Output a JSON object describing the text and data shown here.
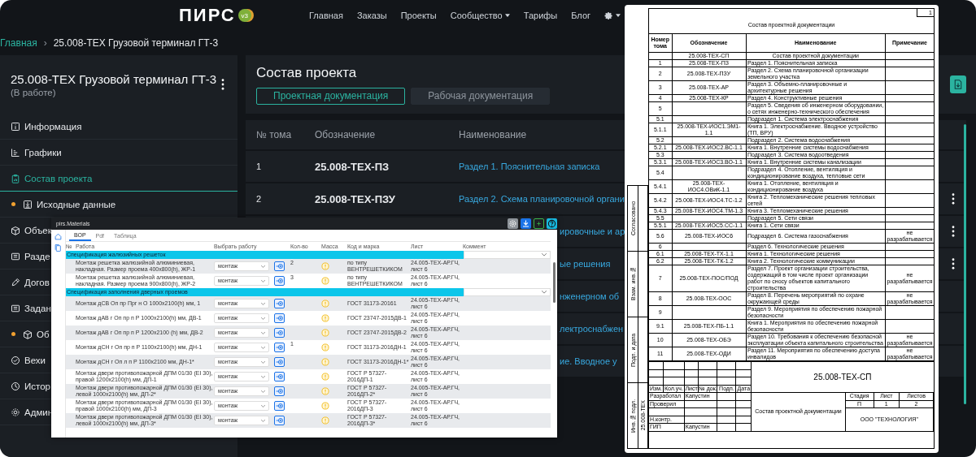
{
  "header": {
    "logo": "ПИРС",
    "logo_badge": "v3",
    "nav": [
      {
        "label": "Главная",
        "dropdown": false
      },
      {
        "label": "Заказы",
        "dropdown": false
      },
      {
        "label": "Проекты",
        "dropdown": false
      },
      {
        "label": "Сообщество",
        "dropdown": true
      },
      {
        "label": "Тарифы",
        "dropdown": false
      },
      {
        "label": "Блог",
        "dropdown": false
      }
    ]
  },
  "breadcrumb": {
    "items": [
      "Главная",
      "25.008-ТЕХ Грузовой терминал ГТ-3"
    ],
    "separator": "›"
  },
  "sidebar": {
    "title": "25.008-ТЕХ Грузовой терминал ГТ-3",
    "status": "(В работе)",
    "items": [
      {
        "label": "Информация",
        "selected": false,
        "dot": false
      },
      {
        "label": "Графики",
        "selected": false,
        "dot": false
      },
      {
        "label": "Состав проекта",
        "selected": true,
        "dot": false
      },
      {
        "label": "Исходные данные",
        "selected": false,
        "dot": true
      },
      {
        "label": "Объек",
        "selected": false,
        "dot": false
      },
      {
        "label": "Разде",
        "selected": false,
        "dot": false
      },
      {
        "label": "Догов",
        "selected": false,
        "dot": false
      },
      {
        "label": "Задан",
        "selected": false,
        "dot": false
      },
      {
        "label": "Об",
        "selected": false,
        "dot": true
      },
      {
        "label": "Вехи",
        "selected": false,
        "dot": false
      },
      {
        "label": "Истор",
        "selected": false,
        "dot": false
      },
      {
        "label": "Админ",
        "selected": false,
        "dot": false
      }
    ]
  },
  "content": {
    "title": "Состав проекта",
    "tabs": [
      {
        "label": "Проектная документация",
        "selected": true
      },
      {
        "label": "Рабочая документация",
        "selected": false
      }
    ],
    "table": {
      "columns": [
        "№ тома",
        "Обозначение",
        "Наименование"
      ],
      "rows": [
        {
          "kind": "full",
          "volume": "1",
          "code": "25.008-ТЕХ-ПЗ",
          "name": "Раздел 1. Пояснительная записка",
          "menu": false
        },
        {
          "kind": "full",
          "volume": "2",
          "code": "25.008-ТЕХ-ПЗУ",
          "name": "Раздел 2. Схема планировочной органи",
          "menu": true
        },
        {
          "kind": "partial",
          "name": "ировочные и ар",
          "menu": true
        },
        {
          "kind": "partial",
          "name": "ые решения",
          "menu": true
        },
        {
          "kind": "partial",
          "name": "нженерном об",
          "menu": false
        },
        {
          "kind": "partial",
          "name": "лектроснабжен",
          "menu": false
        },
        {
          "kind": "partial",
          "name": "ие. Вводное у",
          "menu": false
        }
      ]
    }
  },
  "materials_window": {
    "title": "pirs.Materials",
    "tabs": [
      {
        "label": "ВОР",
        "selected": true
      },
      {
        "label": "Pdf",
        "selected": false
      },
      {
        "label": "Таблица",
        "selected": false
      }
    ],
    "columns": [
      "№",
      "Работа",
      "Выбрать работу",
      "Кол-во",
      "Масса",
      "Код и марка",
      "Лист",
      "Коммент"
    ],
    "groups": [
      {
        "title": "Спецификация жалюзийных решеток",
        "rows": [
          {
            "work": "Монтаж решетка жалюзийной алюминиевая, накладная. Размер проема 400x800(h), ЖР-1",
            "choice": "монтаж",
            "qty": "2",
            "code": "по типу ВЕНТРЕШЕТКИКОМ",
            "sheet": "24.005-ТЕХ-АР.ГЧ, лист 6"
          },
          {
            "work": "Монтаж решетка жалюзийной алюминиевая, накладная. Размер проема 900x800(h), ЖР-2",
            "choice": "монтаж",
            "qty": "3",
            "code": "по типу ВЕНТРЕШЕТКИКОМ",
            "sheet": "24.005-ТЕХ-АР.ГЧ, лист 6"
          }
        ]
      },
      {
        "title": "Спецификация заполнения дверных проемов",
        "rows": [
          {
            "work": "Монтаж дСВ Оп пр Прг н О 1000x2100(h) мм, 1",
            "choice": "монтаж",
            "code": "ГОСТ 31173-20161",
            "sheet": "24.005-ТЕХ-АР.ГЧ, лист 6"
          },
          {
            "work": "Монтаж дАВ г Оп пр п Р 1000x2100(h) мм, ДВ-1",
            "choice": "монтаж",
            "code": "ГОСТ 23747-2015ДВ-1",
            "sheet": "24.005-ТЕХ-АР.ГЧ, лист 6"
          },
          {
            "work": "Монтаж дАВ г Оп пр п Р 1200x2100 (h) мм, ДВ-2",
            "choice": "монтаж",
            "code": "ГОСТ 23747-2015ДВ-2",
            "sheet": "24.005-ТЕХ-АР.ГЧ, лист 6"
          },
          {
            "work": "Монтаж дСН г Оп пр п Р 1100x2100(h) мм, ДН-1",
            "choice": "монтаж",
            "qty": "1",
            "code": "ГОСТ 31173-2016ДН-1",
            "sheet": "24.005-ТЕХ-АР.ГЧ, лист 6"
          },
          {
            "work": "Монтаж дСН г Оп л п Р 1100x2100 мм, ДН-1*",
            "choice": "монтаж",
            "code": "ГОСТ 31173-2016ДН-1*",
            "sheet": "24.005-ТЕХ-АР.ГЧ, лист 6"
          },
          {
            "work": "Монтаж двери противопожарной ДПМ 01/30 (EI 30), правой 1200x2100(h) мм, ДП-1",
            "choice": "монтаж",
            "code": "ГОСТ Р 57327-2016ДП-1",
            "sheet": "24.005-ТЕХ-АР.ГЧ, лист 6"
          },
          {
            "work": "Монтаж двери противопожарной ДПМ 01/30 (EI 30), левой 1000x2100(h) мм, ДП-2*",
            "choice": "монтаж",
            "code": "ГОСТ Р 57327-2016ДП-2*",
            "sheet": "24.005-ТЕХ-АР.ГЧ, лист 6"
          },
          {
            "work": "Монтаж двери противопожарной ДПМ 01/30 (EI 30), правой 1000x2100(h) мм, ДП-3",
            "choice": "монтаж",
            "code": "ГОСТ Р 57327-2016ДП-3",
            "sheet": "24.005-ТЕХ-АР.ГЧ, лист 6"
          },
          {
            "work": "Монтаж двери противопожарной ДПМ 01/30 (EI 30), левой 1000x2100(h) мм, ДП-3*",
            "choice": "монтаж",
            "code": "ГОСТ Р 57327-2016ДП-3*",
            "sheet": "24.005-ТЕХ-АР.ГЧ, лист 6"
          }
        ]
      }
    ]
  },
  "document": {
    "page": "1",
    "title": "Состав проектной документации",
    "columns": [
      "Номер тома",
      "Обозначение",
      "Наименование",
      "Примечание"
    ],
    "side_stamps": [
      {
        "label": "Согласовано"
      },
      {
        "label": "Взам. инв.№"
      },
      {
        "label": "Подп. и дата"
      },
      {
        "label": "Инв.№ подл.",
        "value": "25.008-ТЕХ"
      }
    ],
    "rows": [
      {
        "code": "25.008-ТЕХ-СП",
        "name": "Состав проектной документации",
        "centered": true
      },
      {
        "volume": "1",
        "code": "25.008-ТЕХ-ПЗ",
        "name": "Раздел 1. Пояснительная записка"
      },
      {
        "volume": "2",
        "code": "25.008-ТЕХ-ПЗУ",
        "name": "Раздел 2. Схема планировочной организации земельного участка"
      },
      {
        "volume": "3",
        "code": "25.008-ТЕХ-АР",
        "name": "Раздел 3. Объемно-планировочные и архитектурные решения"
      },
      {
        "volume": "4",
        "code": "25.008-ТЕХ-КР",
        "name": "Раздел 4. Конструктивные решения"
      },
      {
        "volume": "5",
        "name": "Раздел 5. Сведения об инженерном оборудовании, о сетях инженерно-технического обеспечения"
      },
      {
        "volume": "5.1",
        "name": "Подраздел 1. Система электроснабжения"
      },
      {
        "volume": "5.1.1",
        "code": "25.008-ТЕХ-ИОС1.ЭМ1-1.1",
        "name": "Книга 1. Электроснабжение. Вводное устройство (ТП, ВРУ)"
      },
      {
        "volume": "5.2",
        "name": "Подраздел 2. Система водоснабжения"
      },
      {
        "volume": "5.2.1",
        "code": "25.008-ТЕХ-ИОС2.ВС-1.1",
        "name": "Книга 1. Внутренние системы водоснабжения"
      },
      {
        "volume": "5.3",
        "name": "Подраздел 3. Система водоотведения"
      },
      {
        "volume": "5.3.1",
        "code": "25.008-ТЕХ-ИОС3.ВО-1.1",
        "name": "Книга 1. Внутренние системы канализации"
      },
      {
        "volume": "5.4",
        "name": "Подраздел 4. Отопление, вентиляция и кондиционирование воздуха, тепловые сети"
      },
      {
        "volume": "5.4.1",
        "code": "25.008-ТЕХ-ИОС4.ОВиК-1.1",
        "name": "Книга 1. Отопление, вентиляция и кондиционирование воздуха"
      },
      {
        "volume": "5.4.2",
        "code": "25.008-ТЕХ-ИОС4.ТС-1.2",
        "name": "Книга 2. Тепломеханические решения тепловых сетей"
      },
      {
        "volume": "5.4.3",
        "code": "25.008-ТЕХ-ИОС4.ТМ-1.3",
        "name": "Книга 3. Тепломеханические решения"
      },
      {
        "volume": "5.5",
        "name": "Подраздел 5. Сети связи"
      },
      {
        "volume": "5.5.1",
        "code": "25.008-ТЕХ-ИОС5.СС-1.1",
        "name": "Книга 1. Сети связи"
      },
      {
        "volume": "5.6",
        "code": "25.008-ТЕХ-ИОС6",
        "name": "Подраздел 6. Система газоснабжения",
        "note": "не разрабатывается"
      },
      {
        "volume": "6",
        "name": "Раздел 6. Технологические решения"
      },
      {
        "volume": "6.1",
        "code": "25.008-ТЕХ-ТХ-1.1",
        "name": "Книга 1. Технологические решения"
      },
      {
        "volume": "6.2",
        "code": "25.008-ТЕХ-ТК-1.2",
        "name": "Книга 2. Технологические коммуникации"
      },
      {
        "volume": "7",
        "code": "25.008-ТЕХ-ПОС/ПОД",
        "name": "Раздел 7. Проект организации строительства, содержащий в том числе проект организации работ по сносу объектов капитального строительства",
        "note": "не разрабатывается"
      },
      {
        "volume": "8",
        "code": "25.008-ТЕХ-ООС",
        "name": "Раздел 8. Перечень мероприятий по охране окружающей среды",
        "note": "не разрабатывается"
      },
      {
        "volume": "9",
        "name": "Раздел 9. Мероприятия по обеспечению пожарной безопасности"
      },
      {
        "volume": "9.1",
        "code": "25.008-ТЕХ-ПБ-1.1",
        "name": "Книга 1. Мероприятия по обеспечению пожарной безопасности"
      },
      {
        "volume": "10",
        "code": "25.008-ТЕХ-ОБЭ",
        "name": "Раздел 10. Требования к обеспечению безопасной эксплуатации объекта капитального строительства",
        "note": "не разрабатывается"
      },
      {
        "volume": "11",
        "code": "25.008-ТЕХ-ОДИ",
        "name": "Раздел 11. Мероприятия по обеспечению доступа инвалидов",
        "note": "не разрабатывается"
      }
    ],
    "stamp": {
      "columns": [
        "Изм.",
        "Кол.уч.",
        "Лист",
        "№ док.",
        "Подп.",
        "Дата"
      ],
      "people": [
        {
          "role": "Разработал",
          "name": "Капустин"
        },
        {
          "role": "Проверил"
        },
        {
          "role": "Н.контр."
        },
        {
          "role": "ГИП",
          "name": "Капустин"
        }
      ],
      "code": "25.008-ТЕХ-СП",
      "title": "Состав проектной документации",
      "stage_labels": [
        "Стадия",
        "Лист",
        "Листов"
      ],
      "stage_values": [
        "П",
        "1",
        "2"
      ],
      "organization": "ООО \"ТЕХНОЛОГИЯ\""
    }
  }
}
